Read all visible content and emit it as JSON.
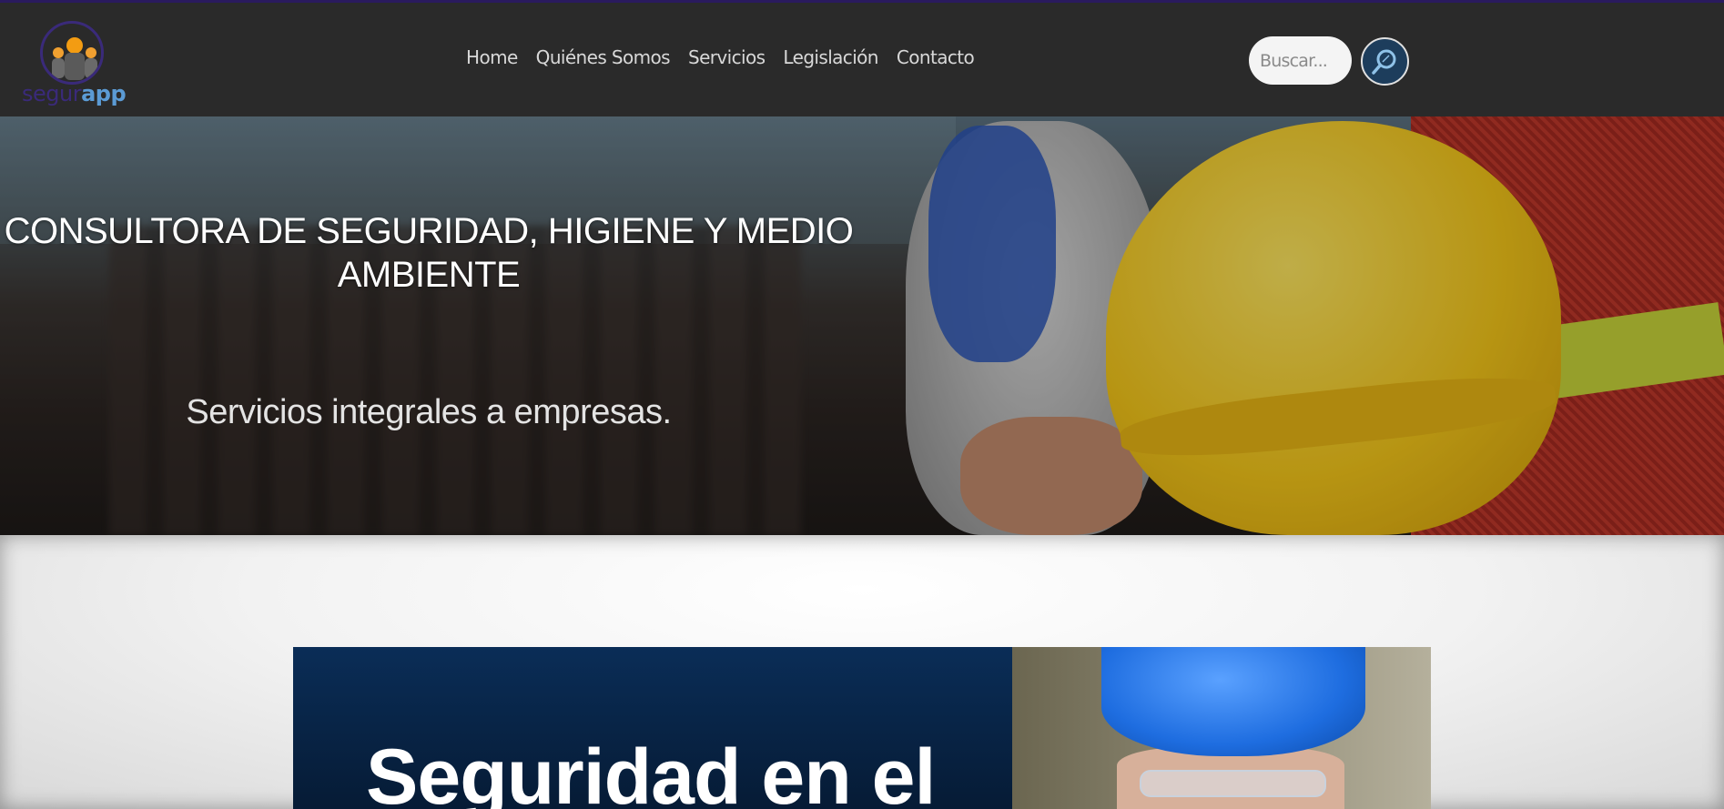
{
  "header": {
    "logo": {
      "text_part1": "segur",
      "text_part2": "app"
    },
    "nav": [
      {
        "label": "Home"
      },
      {
        "label": "Quiénes Somos"
      },
      {
        "label": "Servicios"
      },
      {
        "label": "Legislación"
      },
      {
        "label": "Contacto"
      }
    ],
    "search": {
      "placeholder": "Buscar...",
      "icon": "search-icon"
    }
  },
  "hero": {
    "title": "CONSULTORA DE SEGURIDAD, HIGIENE Y MEDIO AMBIENTE",
    "subtitle": "Servicios integrales a empresas."
  },
  "banner": {
    "title": "Seguridad en el"
  },
  "colors": {
    "header_bg": "#2a2a2a",
    "nav_text": "#d8d8d8",
    "search_button": "#1d3d5c",
    "banner_bg": "#0a2d57"
  }
}
